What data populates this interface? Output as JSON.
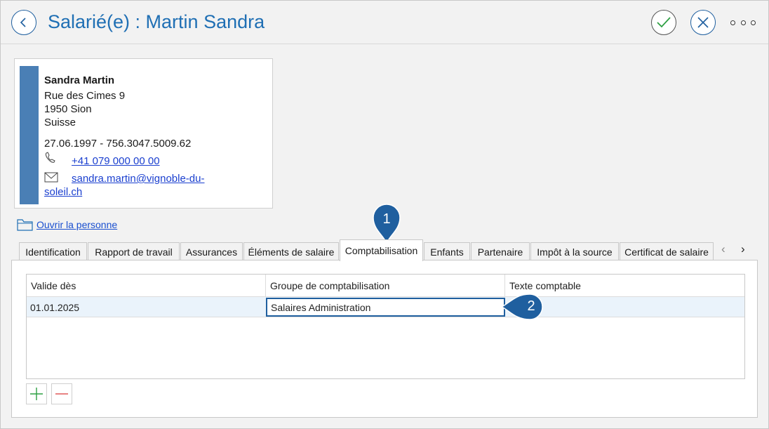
{
  "header": {
    "title": "Salarié(e) : Martin Sandra"
  },
  "person_card": {
    "name": "Sandra Martin",
    "street": "Rue des Cimes 9",
    "city": "1950 Sion",
    "country": "Suisse",
    "birth_ahv": "27.06.1997 - 756.3047.5009.62",
    "phone": "+41 079 000 00 00",
    "email_line1": "sandra.martin@vignoble-du-",
    "email_line2": "soleil.ch"
  },
  "open_person_label": "Ouvrir la personne",
  "tabs": [
    {
      "label": "Identification"
    },
    {
      "label": "Rapport de travail"
    },
    {
      "label": "Assurances"
    },
    {
      "label": "Éléments de salaire"
    },
    {
      "label": "Comptabilisation",
      "active": true
    },
    {
      "label": "Enfants"
    },
    {
      "label": "Partenaire"
    },
    {
      "label": "Impôt à la source"
    },
    {
      "label": "Certificat de salaire"
    }
  ],
  "grid": {
    "columns": [
      "Valide dès",
      "Groupe de comptabilisation",
      "Texte comptable"
    ],
    "rows": [
      [
        "01.01.2025",
        "Salaires Administration",
        ""
      ]
    ]
  },
  "callouts": [
    "1",
    "2"
  ],
  "colors": {
    "accent": "#1f6fb4",
    "callout": "#1f5f9f",
    "card_bar": "#4a7fb5",
    "add_green": "#2ea043",
    "remove_red": "#e05a5a"
  },
  "icons": {
    "back": "chevron-left-icon",
    "confirm": "checkmark-icon",
    "cancel": "close-icon",
    "more": "more-icon",
    "phone": "phone-icon",
    "email": "envelope-icon",
    "folder": "folder-icon",
    "add": "plus-icon",
    "remove": "minus-icon"
  }
}
